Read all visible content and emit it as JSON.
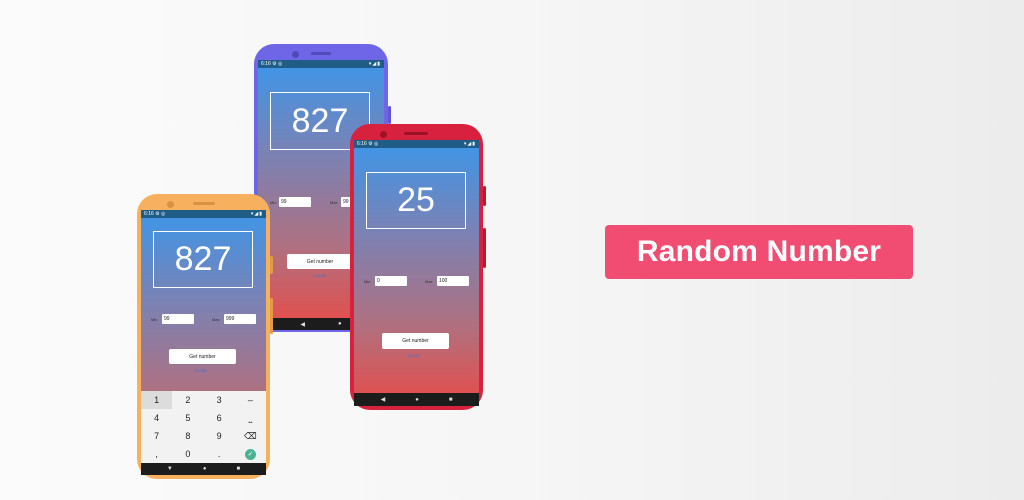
{
  "app": {
    "title": "Random Number"
  },
  "phone_purple": {
    "status": {
      "time": "6:16",
      "icons": "⚙ ◎",
      "right": "▾◢▮"
    },
    "number": "827",
    "min_label": "Min",
    "min_value": "99",
    "max_label": "Max",
    "max_value": "99",
    "button": "Get number",
    "clear": "CLEAR",
    "nav": {
      "back": "◀",
      "home": "●"
    }
  },
  "phone_red": {
    "status": {
      "time": "6:16",
      "icons": "⚙ ◎",
      "right": "▾◢▮"
    },
    "number": "25",
    "min_label": "Min",
    "min_value": "0",
    "max_label": "Max",
    "max_value": "100",
    "button": "Get number",
    "clear": "CLEAR",
    "nav": {
      "back": "◀",
      "home": "●",
      "recents": "■"
    }
  },
  "phone_orange": {
    "status": {
      "time": "6:16",
      "icons": "⚙ ◎",
      "right": "▾◢▮"
    },
    "number": "827",
    "min_label": "Min",
    "min_value": "99",
    "max_label": "Max",
    "max_value": "999",
    "button": "Get number",
    "clear": "CLEAR",
    "keys": [
      "1",
      "2",
      "3",
      "–",
      "4",
      "5",
      "6",
      "⎵",
      "7",
      "8",
      "9",
      "⌫",
      ",",
      "0",
      ".",
      "✓"
    ],
    "nav": {
      "back": "▼",
      "home": "●",
      "recents": "■"
    }
  },
  "colors": {
    "purple_frame": "#6e66e6",
    "red_frame": "#d8213f",
    "orange_frame": "#f7b05d",
    "badge": "#f14d72"
  }
}
